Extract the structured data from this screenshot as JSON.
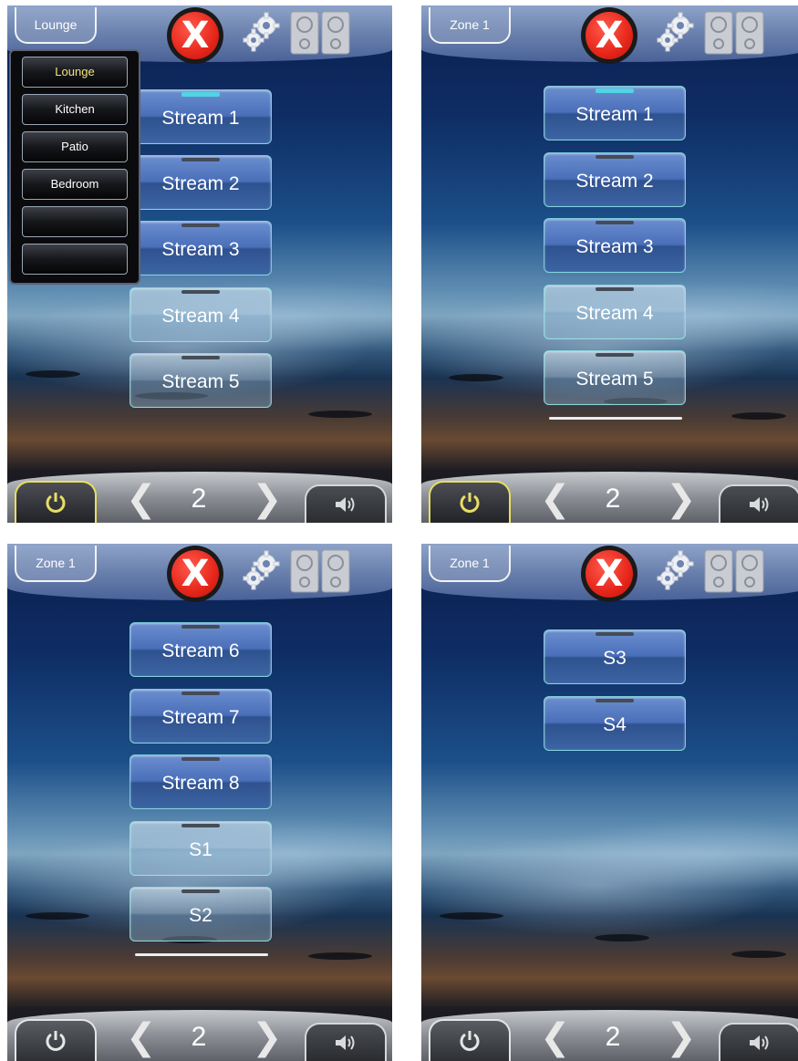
{
  "panels": [
    {
      "zone_label": "Lounge",
      "page_number": "2",
      "power_on": true,
      "dropdown_open": true,
      "rooms": [
        {
          "label": "Lounge",
          "selected": true
        },
        {
          "label": "Kitchen",
          "selected": false
        },
        {
          "label": "Patio",
          "selected": false
        },
        {
          "label": "Bedroom",
          "selected": false
        },
        {
          "label": "",
          "selected": false
        },
        {
          "label": "",
          "selected": false
        }
      ],
      "sources": [
        {
          "label": "Stream 1",
          "active": true
        },
        {
          "label": "Stream 2",
          "active": false
        },
        {
          "label": "Stream 3",
          "active": false
        },
        {
          "label": "Stream 4",
          "active": false
        },
        {
          "label": "Stream 5",
          "active": false
        }
      ]
    },
    {
      "zone_label": "Zone 1",
      "page_number": "2",
      "power_on": true,
      "dropdown_open": false,
      "sources": [
        {
          "label": "Stream 1",
          "active": true
        },
        {
          "label": "Stream 2",
          "active": false
        },
        {
          "label": "Stream 3",
          "active": false
        },
        {
          "label": "Stream 4",
          "active": false
        },
        {
          "label": "Stream 5",
          "active": false
        }
      ]
    },
    {
      "zone_label": "Zone 1",
      "page_number": "2",
      "power_on": false,
      "dropdown_open": false,
      "sources": [
        {
          "label": "Stream 6",
          "active": false
        },
        {
          "label": "Stream 7",
          "active": false
        },
        {
          "label": "Stream 8",
          "active": false
        },
        {
          "label": "S1",
          "active": false
        },
        {
          "label": "S2",
          "active": false
        }
      ]
    },
    {
      "zone_label": "Zone 1",
      "page_number": "2",
      "power_on": false,
      "dropdown_open": false,
      "sources": [
        {
          "label": "S3",
          "active": false
        },
        {
          "label": "S4",
          "active": false
        }
      ]
    }
  ],
  "controls": {
    "close_glyph": "X",
    "prev_glyph": "❮",
    "next_glyph": "❯"
  },
  "icons": {
    "close": "close-icon",
    "settings": "gear-icon",
    "remote": "remote-icon",
    "power": "power-icon",
    "volume": "speaker-icon"
  },
  "colors": {
    "active_tab": "#4fd5e4",
    "power_on_outline": "#e8de63",
    "selected_room": "#f2e27a",
    "close_red": "#e6261a"
  }
}
